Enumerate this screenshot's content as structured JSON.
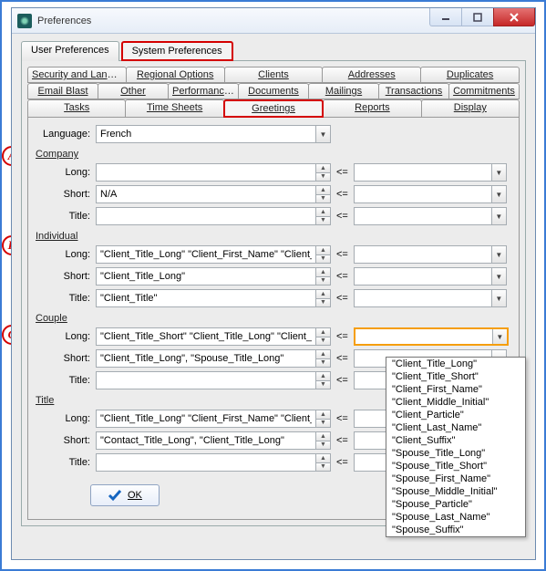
{
  "window": {
    "title": "Preferences"
  },
  "markers": {
    "a": "A",
    "b": "B",
    "c": "C"
  },
  "topTabs": {
    "user": "User Preferences",
    "system": "System Preferences"
  },
  "subTabs": {
    "row1": [
      "Security and Language",
      "Regional Options",
      "Clients",
      "Addresses",
      "Duplicates"
    ],
    "row2": [
      "Email Blast",
      "Other",
      "Performances",
      "Documents",
      "Mailings",
      "Transactions",
      "Commitments"
    ],
    "row3": [
      "Tasks",
      "Time Sheets",
      "Greetings",
      "Reports",
      "Display"
    ]
  },
  "language": {
    "label": "Language:",
    "value": "French"
  },
  "labels": {
    "le": "<=",
    "long": "Long:",
    "short": "Short:",
    "title": "Title:"
  },
  "groups": {
    "company": {
      "label": "Company",
      "long": "",
      "short": "N/A",
      "title": ""
    },
    "individual": {
      "label": "Individual",
      "long": "\"Client_Title_Long\" \"Client_First_Name\" \"Client_L",
      "short": "\"Client_Title_Long\"",
      "title": "\"Client_Title\""
    },
    "couple": {
      "label": "Couple",
      "long": "\"Client_Title_Short\" \"Client_Title_Long\" \"Client_F",
      "short": "\"Client_Title_Long\", \"Spouse_Title_Long\"",
      "title": ""
    },
    "titleGroup": {
      "label": "Title",
      "long": "\"Client_Title_Long\" \"Client_First_Name\" \"Client_M",
      "short": "\"Contact_Title_Long\", \"Client_Title_Long\"",
      "title": ""
    }
  },
  "dropdown": {
    "options": [
      "\"Client_Title_Long\"",
      "\"Client_Title_Short\"",
      "\"Client_First_Name\"",
      "\"Client_Middle_Initial\"",
      "\"Client_Particle\"",
      "\"Client_Last_Name\"",
      "\"Client_Suffix\"",
      "\"Spouse_Title_Long\"",
      "\"Spouse_Title_Short\"",
      "\"Spouse_First_Name\"",
      "\"Spouse_Middle_Initial\"",
      "\"Spouse_Particle\"",
      "\"Spouse_Last_Name\"",
      "\"Spouse_Suffix\""
    ]
  },
  "ok": {
    "label": "OK"
  }
}
